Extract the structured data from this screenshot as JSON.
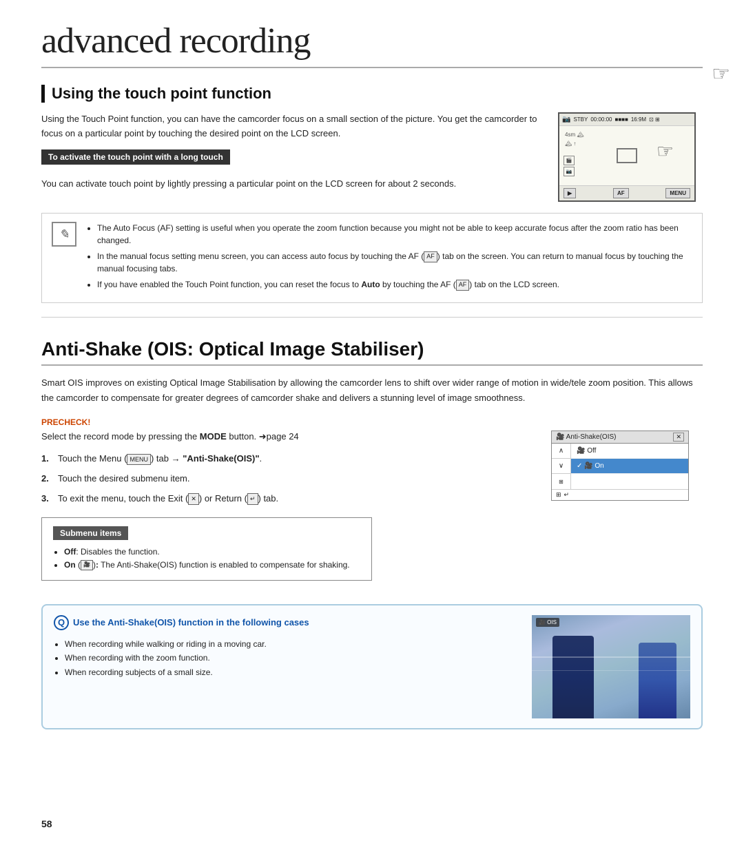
{
  "page": {
    "title": "advanced recording",
    "page_number": "58"
  },
  "touch_point_section": {
    "heading": "Using the touch point function",
    "intro": "Using the Touch Point function, you can have the camcorder focus on a small section of the picture. You get the camcorder to focus on a particular point by touching the desired point on the LCD screen.",
    "subheading": "To activate the touch point with a long touch",
    "body": "You can activate touch point by lightly pressing a particular point on the LCD screen for about 2 seconds."
  },
  "note": {
    "bullets": [
      "The Auto Focus (AF) setting is useful when you operate the zoom function because you might not be able to keep accurate focus after the zoom ratio has been changed.",
      "In the manual focus setting menu screen, you can access auto focus by touching the AF ( ) tab on the screen. You can return to manual focus by touching the manual focusing tabs.",
      "If you have enabled the Touch Point function, you can reset the focus to Auto by touching the AF ( ) tab on the LCD screen."
    ]
  },
  "ois_section": {
    "heading": "Anti-Shake (OIS: Optical Image Stabiliser)",
    "intro": "Smart OIS improves on existing Optical Image Stabilisation by allowing the camcorder lens to shift over wider range of motion in wide/tele zoom position. This allows the camcorder to compensate for greater degrees of camcorder shake and delivers a stunning level of image smoothness.",
    "precheck_label": "PRECHECK!",
    "precheck_text": "Select the record mode by pressing the MODE button. ➜page 24",
    "steps": [
      {
        "num": "1.",
        "text": "Touch the Menu (     ) tab → \"Anti-Shake(OIS)\"."
      },
      {
        "num": "2.",
        "text": "Touch the desired submenu item."
      },
      {
        "num": "3.",
        "text": "To exit the menu, touch the Exit (     ) or Return (     ) tab."
      }
    ],
    "submenu": {
      "title": "Submenu items",
      "items": [
        "Off: Disables the function.",
        "On (     ): The Anti-Shake(OIS) function is enabled to compensate for shaking."
      ]
    },
    "tips": {
      "header": "Use the Anti-Shake(OIS) function in the following cases",
      "bullets": [
        "When recording while walking or riding in a moving car.",
        "When recording with the zoom function.",
        "When recording subjects of a small size."
      ]
    },
    "antishake_ui": {
      "title": "Anti-Shake(OIS)",
      "items": [
        "Off",
        "On"
      ],
      "selected": "On"
    }
  }
}
